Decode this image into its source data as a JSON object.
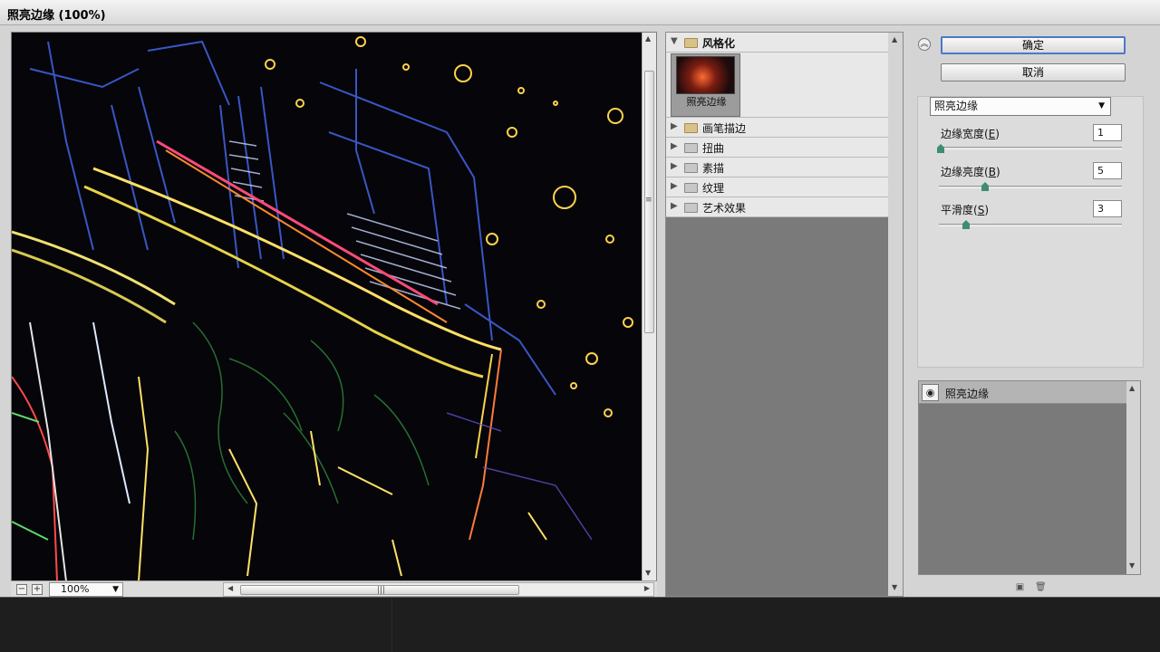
{
  "window": {
    "title": "照亮边缘 (100%)"
  },
  "preview": {
    "zoom_level": "100%",
    "zoom_out": "−",
    "zoom_in": "+",
    "scroll_up": "▲",
    "scroll_down": "▼",
    "scroll_left": "◀",
    "scroll_right": "▶",
    "grip": "≡"
  },
  "filter_list": {
    "open_category": "风格化",
    "open_thumbnail_label": "照亮边缘",
    "categories": [
      "画笔描边",
      "扭曲",
      "素描",
      "纹理",
      "艺术效果"
    ],
    "expanded_arrow": "▼",
    "collapsed_arrow": "▶"
  },
  "controls": {
    "collapse_glyph": "︽",
    "ok_label": "确定",
    "cancel_label": "取消",
    "filter_select": "照亮边缘",
    "params": [
      {
        "label": "边缘宽度",
        "shortcut": "E",
        "value": "1",
        "slider_fraction": 0.0
      },
      {
        "label": "边缘亮度",
        "shortcut": "B",
        "value": "5",
        "slider_fraction": 0.25
      },
      {
        "label": "平滑度",
        "shortcut": "S",
        "value": "3",
        "slider_fraction": 0.15
      }
    ]
  },
  "layers": {
    "items": [
      {
        "label": "照亮边缘",
        "visible": true
      }
    ],
    "eye_glyph": "◉",
    "new_glyph": "▣",
    "delete_glyph": "🗑"
  }
}
